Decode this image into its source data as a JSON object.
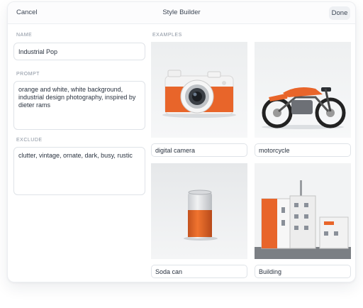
{
  "header": {
    "cancel_label": "Cancel",
    "title": "Style Builder",
    "done_label": "Done"
  },
  "form": {
    "name_label": "NAME",
    "name_value": "Industrial Pop",
    "prompt_label": "PROMPT",
    "prompt_value": "orange and white, white background, industrial design photography, inspired by dieter rams",
    "exclude_label": "EXCLUDE",
    "exclude_value": "clutter, vintage, ornate, dark, busy, rustic"
  },
  "examples": {
    "label": "EXAMPLES",
    "items": [
      {
        "caption": "digital camera",
        "icon": "camera-image"
      },
      {
        "caption": "motorcycle",
        "icon": "motorcycle-image"
      },
      {
        "caption": "Soda can",
        "icon": "soda-can-image"
      },
      {
        "caption": "Building",
        "icon": "building-image"
      }
    ]
  },
  "colors": {
    "accent_orange": "#e8652a",
    "text": "#2a3340",
    "muted": "#8a93a0",
    "border": "#dfe3e8"
  }
}
